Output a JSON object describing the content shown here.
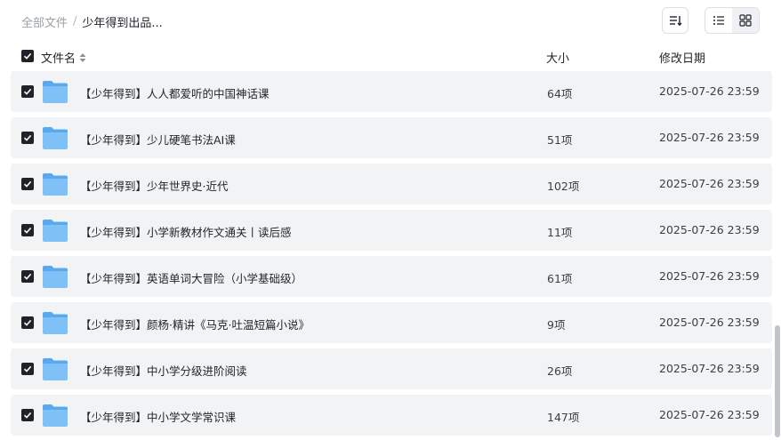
{
  "breadcrumb": {
    "root": "全部文件",
    "separator": "/",
    "current": "少年得到出品..."
  },
  "toolbar": {
    "sort_icon": "sort-icon",
    "list_view_icon": "list-view-icon",
    "grid_view_icon": "grid-view-icon",
    "active_view": "list"
  },
  "table": {
    "headers": {
      "name": "文件名",
      "size": "大小",
      "modified": "修改日期"
    },
    "rows": [
      {
        "name": "【少年得到】人人都爱听的中国神话课",
        "size": "64项",
        "modified": "2025-07-26 23:59",
        "checked": true
      },
      {
        "name": "【少年得到】少儿硬笔书法AI课",
        "size": "51项",
        "modified": "2025-07-26 23:59",
        "checked": true
      },
      {
        "name": "【少年得到】少年世界史·近代",
        "size": "102项",
        "modified": "2025-07-26 23:59",
        "checked": true
      },
      {
        "name": "【少年得到】小学新教材作文通关丨读后感",
        "size": "11项",
        "modified": "2025-07-26 23:59",
        "checked": true
      },
      {
        "name": "【少年得到】英语单词大冒险（小学基础级）",
        "size": "61项",
        "modified": "2025-07-26 23:59",
        "checked": true
      },
      {
        "name": "【少年得到】颜杨·精讲《马克·吐温短篇小说》",
        "size": "9项",
        "modified": "2025-07-26 23:59",
        "checked": true
      },
      {
        "name": "【少年得到】中小学分级进阶阅读",
        "size": "26项",
        "modified": "2025-07-26 23:59",
        "checked": true
      },
      {
        "name": "【少年得到】中小学文学常识课",
        "size": "147项",
        "modified": "2025-07-26 23:59",
        "checked": true
      }
    ]
  },
  "colors": {
    "row_background": "#f2f3f5",
    "folder_blue": "#6cb6f5",
    "checkbox": "#1f2329"
  }
}
